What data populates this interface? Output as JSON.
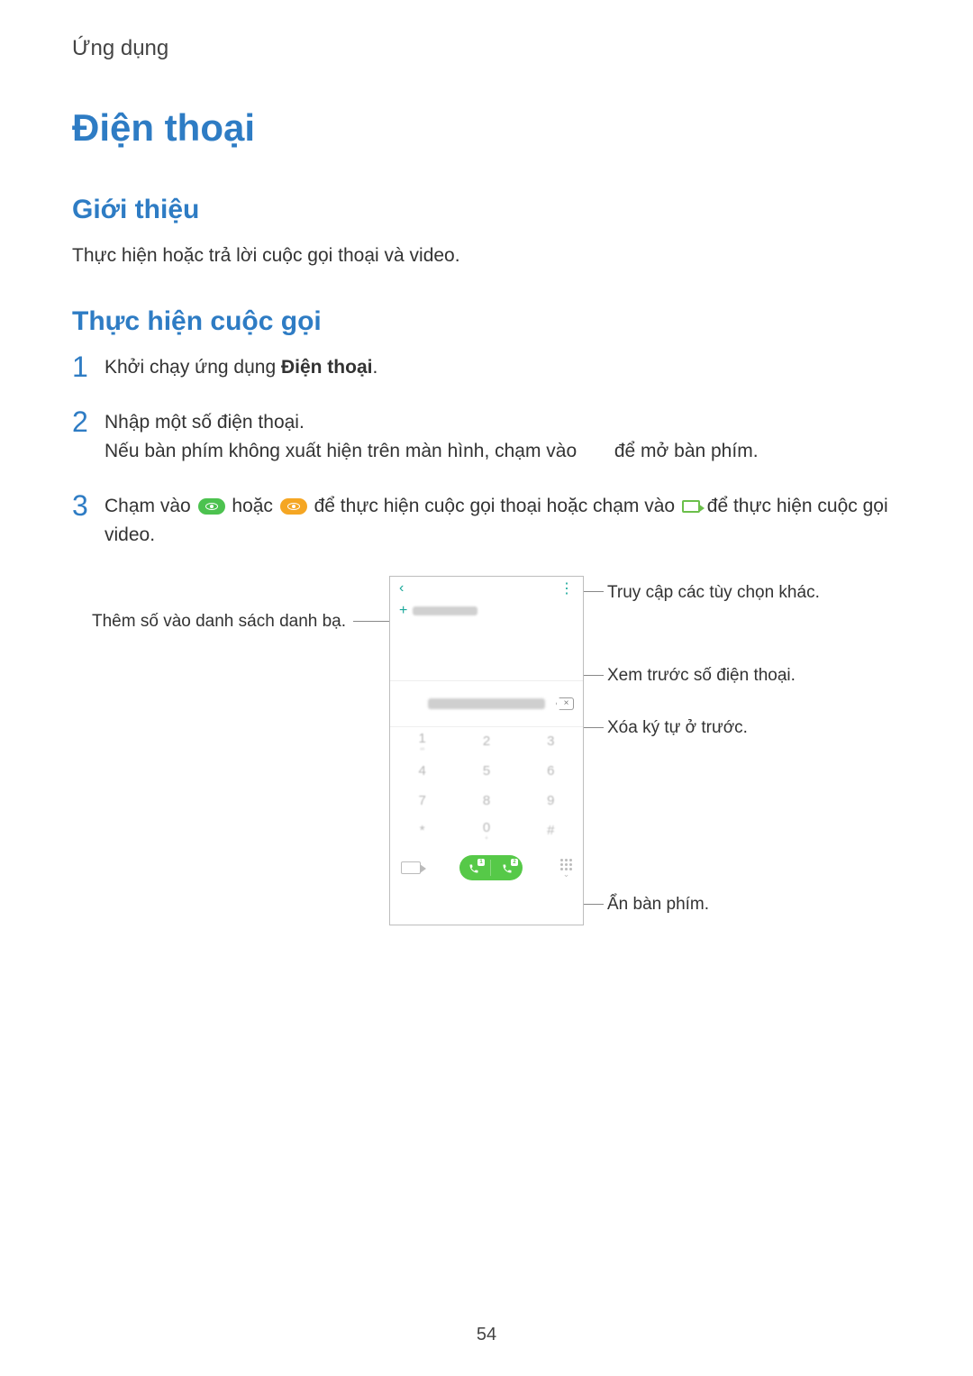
{
  "header": "Ứng dụng",
  "title": "Điện thoại",
  "section1": {
    "heading": "Giới thiệu",
    "text": "Thực hiện hoặc trả lời cuộc gọi thoại và video."
  },
  "section2": {
    "heading": "Thực hiện cuộc gọi"
  },
  "steps": {
    "s1": {
      "num": "1",
      "pre": "Khởi chạy ứng dụng ",
      "bold": "Điện thoại",
      "post": "."
    },
    "s2": {
      "num": "2",
      "line1": "Nhập một số điện thoại.",
      "line2a": "Nếu bàn phím không xuất hiện trên màn hình, chạm vào ",
      "line2b": " để mở bàn phím."
    },
    "s3": {
      "num": "3",
      "a": "Chạm vào ",
      "b": " hoặc ",
      "c": " để thực hiện cuộc gọi thoại hoặc chạm vào ",
      "d": " để thực hiện cuộc gọi video."
    }
  },
  "callouts": {
    "add_contact": "Thêm số vào danh sách danh bạ.",
    "more_options": "Truy cập các tùy chọn khác.",
    "preview_number": "Xem trước số điện thoại.",
    "delete_char": "Xóa ký tự ở trước.",
    "hide_keypad": "Ẩn bàn phím."
  },
  "keypad": {
    "keys": [
      {
        "d": "1",
        "s": "∞"
      },
      {
        "d": "2",
        "s": ""
      },
      {
        "d": "3",
        "s": ""
      },
      {
        "d": "4",
        "s": ""
      },
      {
        "d": "5",
        "s": ""
      },
      {
        "d": "6",
        "s": ""
      },
      {
        "d": "7",
        "s": ""
      },
      {
        "d": "8",
        "s": ""
      },
      {
        "d": "9",
        "s": ""
      },
      {
        "d": "*",
        "s": ""
      },
      {
        "d": "0",
        "s": "+"
      },
      {
        "d": "#",
        "s": ""
      }
    ]
  },
  "sim": {
    "a": "1",
    "b": "2"
  },
  "page_number": "54"
}
